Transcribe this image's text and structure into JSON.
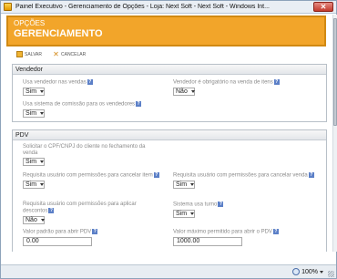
{
  "window": {
    "title": "Painel Executivo - Gerenciamento de Opções - Loja: Next Soft - Next Soft - Windows Int..."
  },
  "banner": {
    "subtitle": "OPÇÕES",
    "title": "GERENCIAMENTO"
  },
  "toolbar": {
    "save_label": "SALVAR",
    "cancel_label": "CANCELAR"
  },
  "vendedor": {
    "header": "Vendedor",
    "usa_vendedor": {
      "label": "Usa vendedor nas vendas",
      "value": "Sim"
    },
    "vendedor_obrigatorio": {
      "label": "Vendedor é obrigatório na venda de itens",
      "value": "Não"
    },
    "usa_comissao": {
      "label": "Usa sistema de comissão para os vendedores",
      "value": "Sim"
    }
  },
  "pdv": {
    "header": "PDV",
    "solicitar_cpf": {
      "label": "Solicitar o CPF/CNPJ do cliente no fechamento da venda",
      "value": "Sim"
    },
    "perm_cancelar_item": {
      "label": "Requisita usuário com permissões para cancelar item",
      "value": "Sim"
    },
    "perm_cancelar_venda": {
      "label": "Requisita usuário com permissões para cancelar venda",
      "value": "Sim"
    },
    "perm_descontos": {
      "label": "Requisita usuário com permissões para aplicar descontos",
      "value": "Não"
    },
    "usa_turno": {
      "label": "Sistema usa turno",
      "value": "Sim"
    },
    "valor_padrao": {
      "label": "Valor padrão para abrir PDV",
      "value": "0.00"
    },
    "valor_maximo": {
      "label": "Valor máximo permitido para abrir o PDV",
      "value": "1000.00"
    }
  },
  "statusbar": {
    "zoom": "100%"
  },
  "colors": {
    "banner": "#f2a52a",
    "help_icon": "#5b7fc7"
  }
}
